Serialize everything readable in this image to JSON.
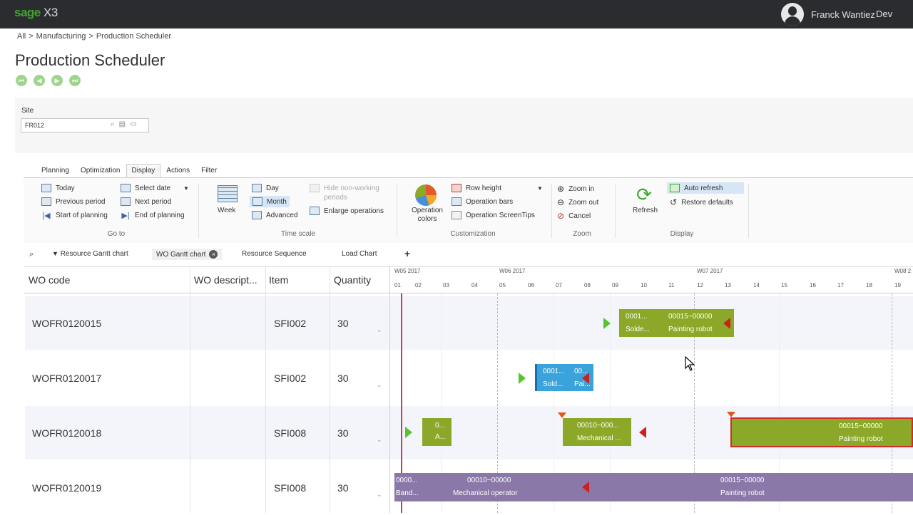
{
  "app": {
    "brand_sage": "sage",
    "brand_x3": "X3"
  },
  "user": {
    "name": "Franck Wantiez",
    "extra": "Dev"
  },
  "breadcrumb": [
    {
      "label": "All",
      "sep": ">"
    },
    {
      "label": "Manufacturing",
      "sep": ">"
    },
    {
      "label": "Production Scheduler"
    }
  ],
  "page_title": "Production Scheduler",
  "site": {
    "label": "Site",
    "value": "FR012"
  },
  "ribbon_tabs": [
    "Planning",
    "Optimization",
    "Display",
    "Actions",
    "Filter"
  ],
  "ribbon": {
    "goto": {
      "today": "Today",
      "select_date": "Select date",
      "previous_period": "Previous period",
      "next_period": "Next period",
      "start_planning": "Start of planning",
      "end_planning": "End of planning",
      "group": "Go to"
    },
    "timescale": {
      "week": "Week",
      "day": "Day",
      "month": "Month",
      "advanced": "Advanced",
      "hide_nonworking": "Hide non-working periods",
      "enlarge": "Enlarge operations",
      "group": "Time scale"
    },
    "custom": {
      "op_colors": "Operation colors",
      "row_height": "Row height",
      "op_bars": "Operation bars",
      "op_tips": "Operation ScreenTips",
      "group": "Customization"
    },
    "zoom": {
      "zoom_in": "Zoom in",
      "zoom_out": "Zoom out",
      "cancel": "Cancel",
      "group": "Zoom"
    },
    "display": {
      "refresh": "Refresh",
      "auto_refresh": "Auto refresh",
      "restore": "Restore defaults",
      "group": "Display"
    }
  },
  "chart_tabs": {
    "resource_gantt": "Resource Gantt chart",
    "wo_gantt": "WO Gantt chart",
    "resource_seq": "Resource Sequence",
    "load_chart": "Load Chart",
    "add": "+"
  },
  "columns": {
    "wo_code": "WO code",
    "wo_desc": "WO descript...",
    "item": "Item",
    "quantity": "Quantity"
  },
  "rows": [
    {
      "wo_code": "WOFR0120015",
      "item": "SFI002",
      "quantity": "30"
    },
    {
      "wo_code": "WOFR0120017",
      "item": "SFI002",
      "quantity": "30"
    },
    {
      "wo_code": "WOFR0120018",
      "item": "SFI008",
      "quantity": "30"
    },
    {
      "wo_code": "WOFR0120019",
      "item": "SFI008",
      "quantity": "30"
    }
  ],
  "gantt": {
    "weeks": [
      "W05 2017",
      "W06 2017",
      "W07 2017",
      "W08 2"
    ],
    "days": [
      "01",
      "02",
      "03",
      "04",
      "05",
      "06",
      "07",
      "08",
      "09",
      "10",
      "11",
      "12",
      "13",
      "14",
      "15",
      "16",
      "17",
      "18",
      "19"
    ],
    "bars": {
      "r1a1": "0001...",
      "r1a2": "Solde...",
      "r1b1": "00015~00000",
      "r1b2": "Painting robot",
      "r2a1": "0001...",
      "r2a2": "Sold...",
      "r2b1": "00...",
      "r2b2": "Pai...",
      "r3a1": "0...",
      "r3a2": "A...",
      "r3b1": "00010~000...",
      "r3b2": "Mechanical ...",
      "r3c1": "00015~00000",
      "r3c2": "Painting robot",
      "r4a1": "0000...",
      "r4a2": "Band...",
      "r4b1": "00010~00000",
      "r4b2": "Mechanical operator",
      "r4c1": "00015~00000",
      "r4c2": "Painting robot"
    }
  }
}
